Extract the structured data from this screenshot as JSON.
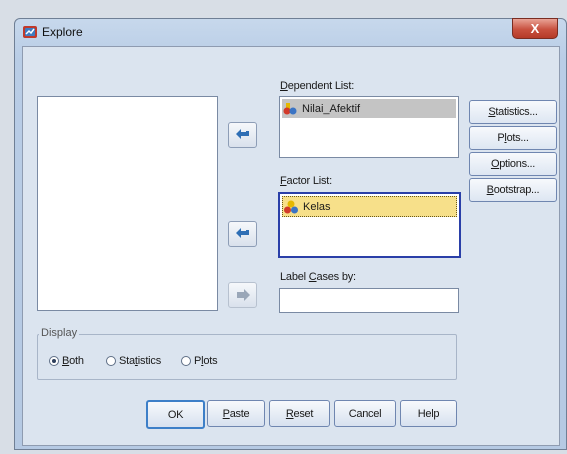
{
  "window": {
    "title": "Explore",
    "close_label": "X"
  },
  "lists": {
    "dependent_label_pre": "",
    "dependent_label_u": "D",
    "dependent_label_post": "ependent List:",
    "dependent_items": [
      "Nilai_Afektif"
    ],
    "factor_label_pre": "",
    "factor_label_u": "F",
    "factor_label_post": "actor List:",
    "factor_items": [
      "Kelas"
    ],
    "label_cases_pre": "Label ",
    "label_cases_u": "C",
    "label_cases_post": "ases by:",
    "label_cases_value": ""
  },
  "side_buttons": {
    "statistics_u": "S",
    "statistics_rest": "tatistics...",
    "plots_pre": "P",
    "plots_u": "l",
    "plots_rest": "ots...",
    "options_u": "O",
    "options_rest": "ptions...",
    "bootstrap_u": "B",
    "bootstrap_rest": "ootstrap..."
  },
  "display": {
    "caption": "Display",
    "both_u": "B",
    "both_rest": "oth",
    "statistics_pre": "Sta",
    "statistics_u": "t",
    "statistics_rest": "istics",
    "plots_pre": "P",
    "plots_u": "l",
    "plots_rest": "ots",
    "selected": "Both"
  },
  "buttons": {
    "ok": "OK",
    "paste_u": "P",
    "paste_rest": "aste",
    "reset_u": "R",
    "reset_rest": "eset",
    "cancel": "Cancel",
    "help": "Help"
  }
}
